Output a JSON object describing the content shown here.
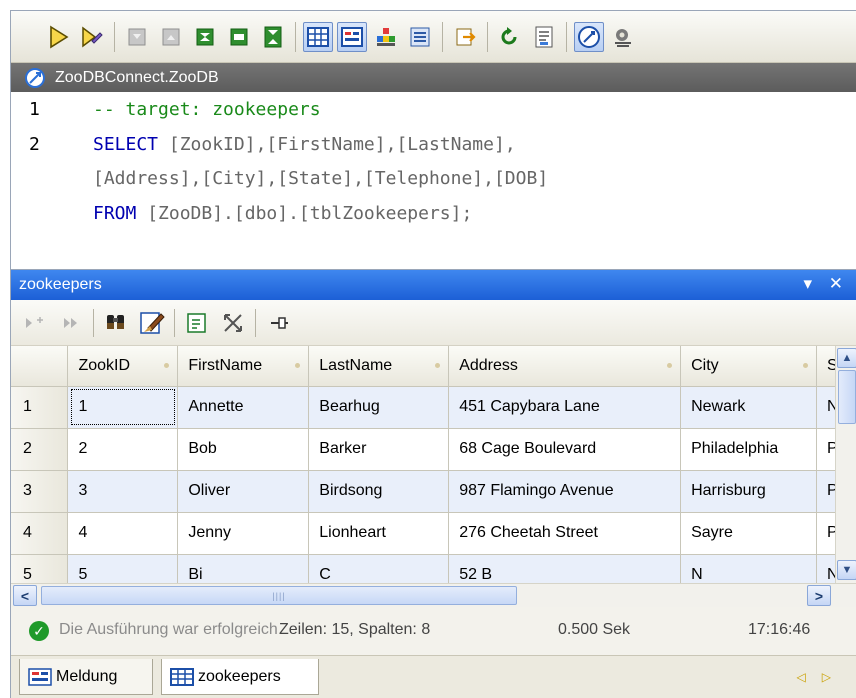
{
  "connection": {
    "title": "ZooDBConnect.ZooDB"
  },
  "editor": {
    "line_numbers": [
      "1",
      "2"
    ],
    "lines": {
      "l1": {
        "comment": "-- target: zookeepers"
      },
      "l2": {
        "kw": "SELECT",
        "rest": " [ZookID],[FirstName],[LastName],"
      },
      "l3": {
        "rest": "[Address],[City],[State],[Telephone],[DOB]"
      },
      "l4": {
        "kw": "FROM",
        "rest": " [ZooDB].[dbo].[tblZookeepers];"
      }
    }
  },
  "result_panel": {
    "title": "zookeepers",
    "controls": "▾ ✕"
  },
  "grid": {
    "columns": [
      "ZookID",
      "FirstName",
      "LastName",
      "Address",
      "City",
      "S"
    ],
    "rows": [
      {
        "num": "1",
        "cells": [
          "1",
          "Annette",
          "Bearhug",
          "451 Capybara Lane",
          "Newark",
          "N"
        ]
      },
      {
        "num": "2",
        "cells": [
          "2",
          "Bob",
          "Barker",
          "68 Cage Boulevard",
          "Philadelphia",
          "P"
        ]
      },
      {
        "num": "3",
        "cells": [
          "3",
          "Oliver",
          "Birdsong",
          "987 Flamingo Avenue",
          "Harrisburg",
          "P"
        ]
      },
      {
        "num": "4",
        "cells": [
          "4",
          "Jenny",
          "Lionheart",
          "276 Cheetah Street",
          "Sayre",
          "P"
        ]
      },
      {
        "num": "5",
        "cells": [
          "5",
          "Bi",
          "C",
          "52 B",
          "N",
          "N"
        ]
      }
    ]
  },
  "status": {
    "message": "Die Ausführung war erfolgreich",
    "rows_cols": "Zeilen: 15, Spalten: 8",
    "duration": "0.500 Sek",
    "clock": "17:16:46"
  },
  "tabs": [
    {
      "label": "Meldung"
    },
    {
      "label": "zookeepers"
    }
  ],
  "icons": {
    "toolbar": [
      "execute-icon",
      "execute-for-editing-icon",
      "first-record-icon",
      "previous-record-icon",
      "next-record-icon",
      "last-record-icon",
      "stop-icon",
      "grid-view-icon",
      "form-view-icon",
      "chart-icon",
      "browser-icon",
      "export-icon",
      "undo-icon",
      "properties-icon",
      "connection-icon",
      "settings-icon"
    ],
    "result_toolbar": [
      "add-row-icon",
      "next-row-icon",
      "find-icon",
      "edit-icon",
      "copy-icon",
      "fit-icon",
      "pin-icon"
    ]
  },
  "colors": {
    "panel_header": "#1c5fd6",
    "connection_bar": "#5c5c5c",
    "comment": "#1a8a1a",
    "keyword": "#0000b0",
    "success": "#1f9a2a"
  }
}
